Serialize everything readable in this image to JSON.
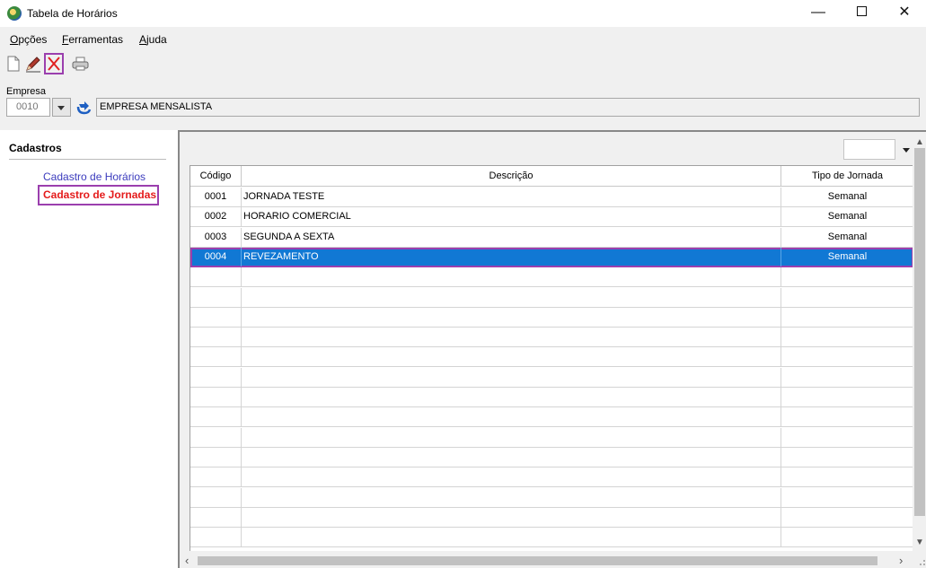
{
  "window": {
    "title": "Tabela de Horários",
    "minimize": "—",
    "close": "✕"
  },
  "menu": [
    {
      "prefix": "",
      "underline": "O",
      "rest": "pções"
    },
    {
      "prefix": "",
      "underline": "F",
      "rest": "erramentas"
    },
    {
      "prefix": "",
      "underline": "A",
      "rest": "juda"
    }
  ],
  "toolbar": {
    "icons": [
      "new-document-icon",
      "edit-pencil-icon",
      "delete-x-icon",
      "printer-icon"
    ]
  },
  "empresa": {
    "label": "Empresa",
    "code": "0010",
    "name": "EMPRESA MENSALISTA"
  },
  "sidebar": {
    "title": "Cadastros",
    "items": [
      {
        "label": "Cadastro de Horários",
        "active": false
      },
      {
        "label": "Cadastro de Jornadas",
        "active": true
      }
    ]
  },
  "grid": {
    "columns": [
      "Código",
      "Descrição",
      "Tipo de Jornada"
    ],
    "rows": [
      {
        "codigo": "0001",
        "descricao": "JORNADA TESTE",
        "tipo": "Semanal"
      },
      {
        "codigo": "0002",
        "descricao": "HORARIO COMERCIAL",
        "tipo": "Semanal"
      },
      {
        "codigo": "0003",
        "descricao": "SEGUNDA A SEXTA",
        "tipo": "Semanal"
      },
      {
        "codigo": "0004",
        "descricao": "REVEZAMENTO",
        "tipo": "Semanal"
      }
    ],
    "selected_index": 3,
    "empty_rows": 14
  },
  "colors": {
    "selection": "#1178d4",
    "highlight_border": "#9b3fae",
    "active_link": "#e41b1b",
    "link": "#3b3bbd"
  }
}
